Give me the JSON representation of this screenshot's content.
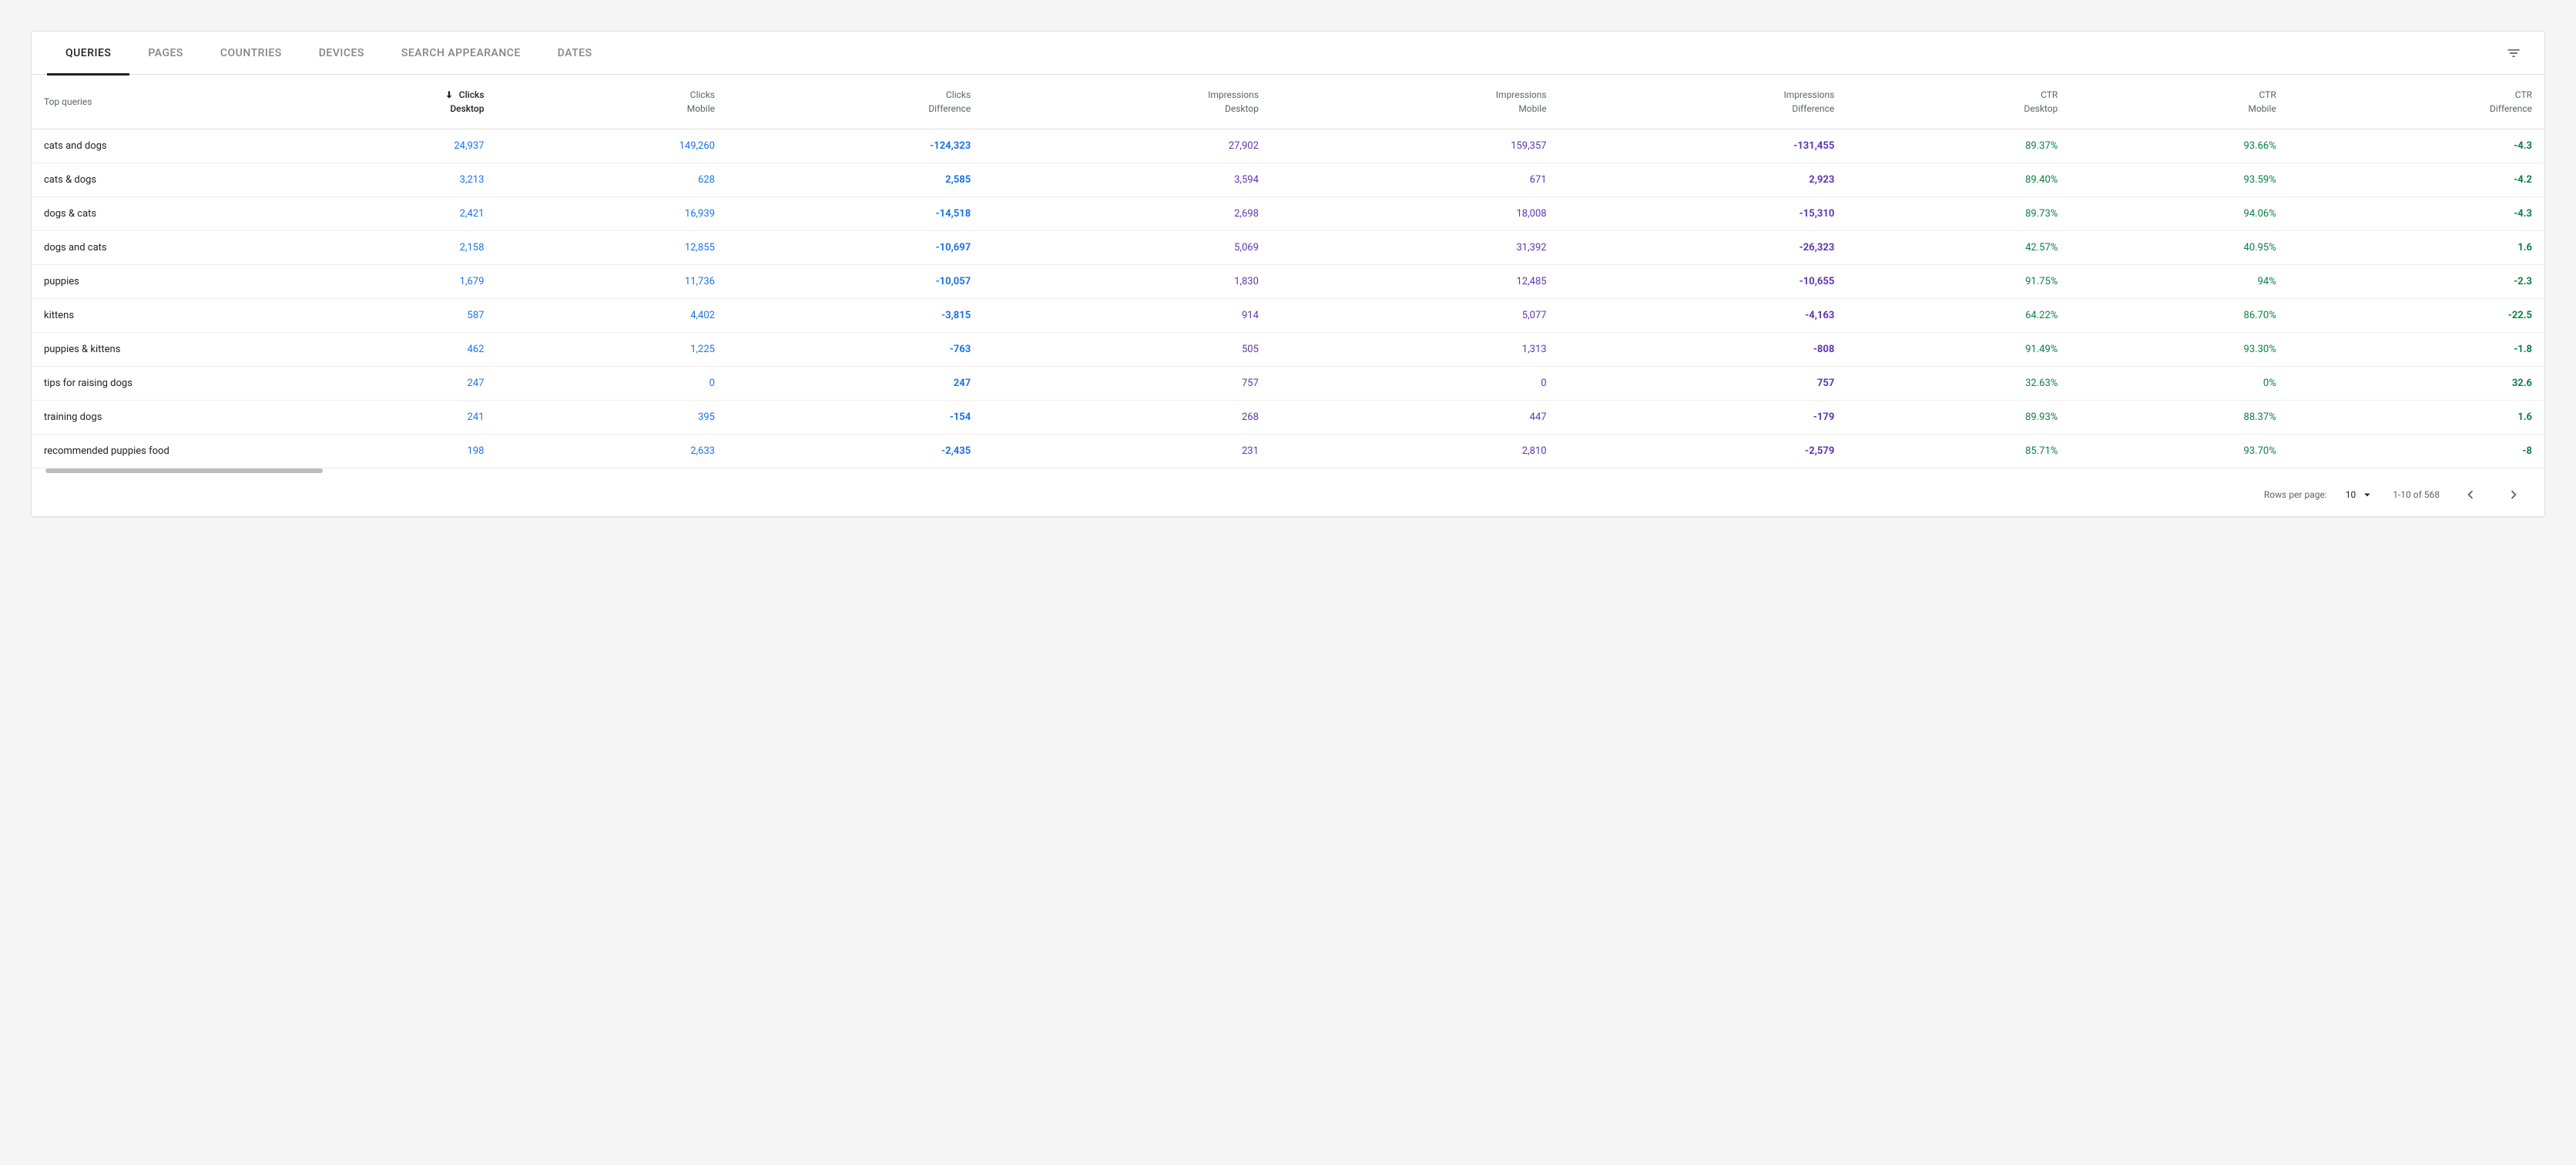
{
  "tabs": {
    "queries": "QUERIES",
    "pages": "PAGES",
    "countries": "COUNTRIES",
    "devices": "DEVICES",
    "search_appearance": "SEARCH APPEARANCE",
    "dates": "DATES"
  },
  "columns": {
    "query": {
      "l1": "Top queries",
      "l2": ""
    },
    "clicks_desktop": {
      "l1": "Clicks",
      "l2": "Desktop"
    },
    "clicks_mobile": {
      "l1": "Clicks",
      "l2": "Mobile"
    },
    "clicks_diff": {
      "l1": "Clicks",
      "l2": "Difference"
    },
    "impr_desktop": {
      "l1": "Impressions",
      "l2": "Desktop"
    },
    "impr_mobile": {
      "l1": "Impressions",
      "l2": "Mobile"
    },
    "impr_diff": {
      "l1": "Impressions",
      "l2": "Difference"
    },
    "ctr_desktop": {
      "l1": "CTR",
      "l2": "Desktop"
    },
    "ctr_mobile": {
      "l1": "CTR",
      "l2": "Mobile"
    },
    "ctr_diff": {
      "l1": "CTR",
      "l2": "Difference"
    }
  },
  "rows": [
    {
      "query": "cats and dogs",
      "clicks_desktop": "24,937",
      "clicks_mobile": "149,260",
      "clicks_diff": "-124,323",
      "impr_desktop": "27,902",
      "impr_mobile": "159,357",
      "impr_diff": "-131,455",
      "ctr_desktop": "89.37%",
      "ctr_mobile": "93.66%",
      "ctr_diff": "-4.3"
    },
    {
      "query": "cats & dogs",
      "clicks_desktop": "3,213",
      "clicks_mobile": "628",
      "clicks_diff": "2,585",
      "impr_desktop": "3,594",
      "impr_mobile": "671",
      "impr_diff": "2,923",
      "ctr_desktop": "89.40%",
      "ctr_mobile": "93.59%",
      "ctr_diff": "-4.2"
    },
    {
      "query": "dogs & cats",
      "clicks_desktop": "2,421",
      "clicks_mobile": "16,939",
      "clicks_diff": "-14,518",
      "impr_desktop": "2,698",
      "impr_mobile": "18,008",
      "impr_diff": "-15,310",
      "ctr_desktop": "89.73%",
      "ctr_mobile": "94.06%",
      "ctr_diff": "-4.3"
    },
    {
      "query": "dogs and cats",
      "clicks_desktop": "2,158",
      "clicks_mobile": "12,855",
      "clicks_diff": "-10,697",
      "impr_desktop": "5,069",
      "impr_mobile": "31,392",
      "impr_diff": "-26,323",
      "ctr_desktop": "42.57%",
      "ctr_mobile": "40.95%",
      "ctr_diff": "1.6"
    },
    {
      "query": "puppies",
      "clicks_desktop": "1,679",
      "clicks_mobile": "11,736",
      "clicks_diff": "-10,057",
      "impr_desktop": "1,830",
      "impr_mobile": "12,485",
      "impr_diff": "-10,655",
      "ctr_desktop": "91.75%",
      "ctr_mobile": "94%",
      "ctr_diff": "-2.3"
    },
    {
      "query": "kittens",
      "clicks_desktop": "587",
      "clicks_mobile": "4,402",
      "clicks_diff": "-3,815",
      "impr_desktop": "914",
      "impr_mobile": "5,077",
      "impr_diff": "-4,163",
      "ctr_desktop": "64.22%",
      "ctr_mobile": "86.70%",
      "ctr_diff": "-22.5"
    },
    {
      "query": "puppies & kittens",
      "clicks_desktop": "462",
      "clicks_mobile": "1,225",
      "clicks_diff": "-763",
      "impr_desktop": "505",
      "impr_mobile": "1,313",
      "impr_diff": "-808",
      "ctr_desktop": "91.49%",
      "ctr_mobile": "93.30%",
      "ctr_diff": "-1.8"
    },
    {
      "query": "tips for raising dogs",
      "clicks_desktop": "247",
      "clicks_mobile": "0",
      "clicks_diff": "247",
      "impr_desktop": "757",
      "impr_mobile": "0",
      "impr_diff": "757",
      "ctr_desktop": "32.63%",
      "ctr_mobile": "0%",
      "ctr_diff": "32.6"
    },
    {
      "query": "training dogs",
      "clicks_desktop": "241",
      "clicks_mobile": "395",
      "clicks_diff": "-154",
      "impr_desktop": "268",
      "impr_mobile": "447",
      "impr_diff": "-179",
      "ctr_desktop": "89.93%",
      "ctr_mobile": "88.37%",
      "ctr_diff": "1.6"
    },
    {
      "query": "recommended puppies food",
      "clicks_desktop": "198",
      "clicks_mobile": "2,633",
      "clicks_diff": "-2,435",
      "impr_desktop": "231",
      "impr_mobile": "2,810",
      "impr_diff": "-2,579",
      "ctr_desktop": "85.71%",
      "ctr_mobile": "93.70%",
      "ctr_diff": "-8"
    }
  ],
  "footer": {
    "rows_per_page_label": "Rows per page:",
    "rows_per_page_value": "10",
    "range": "1-10 of 568"
  }
}
